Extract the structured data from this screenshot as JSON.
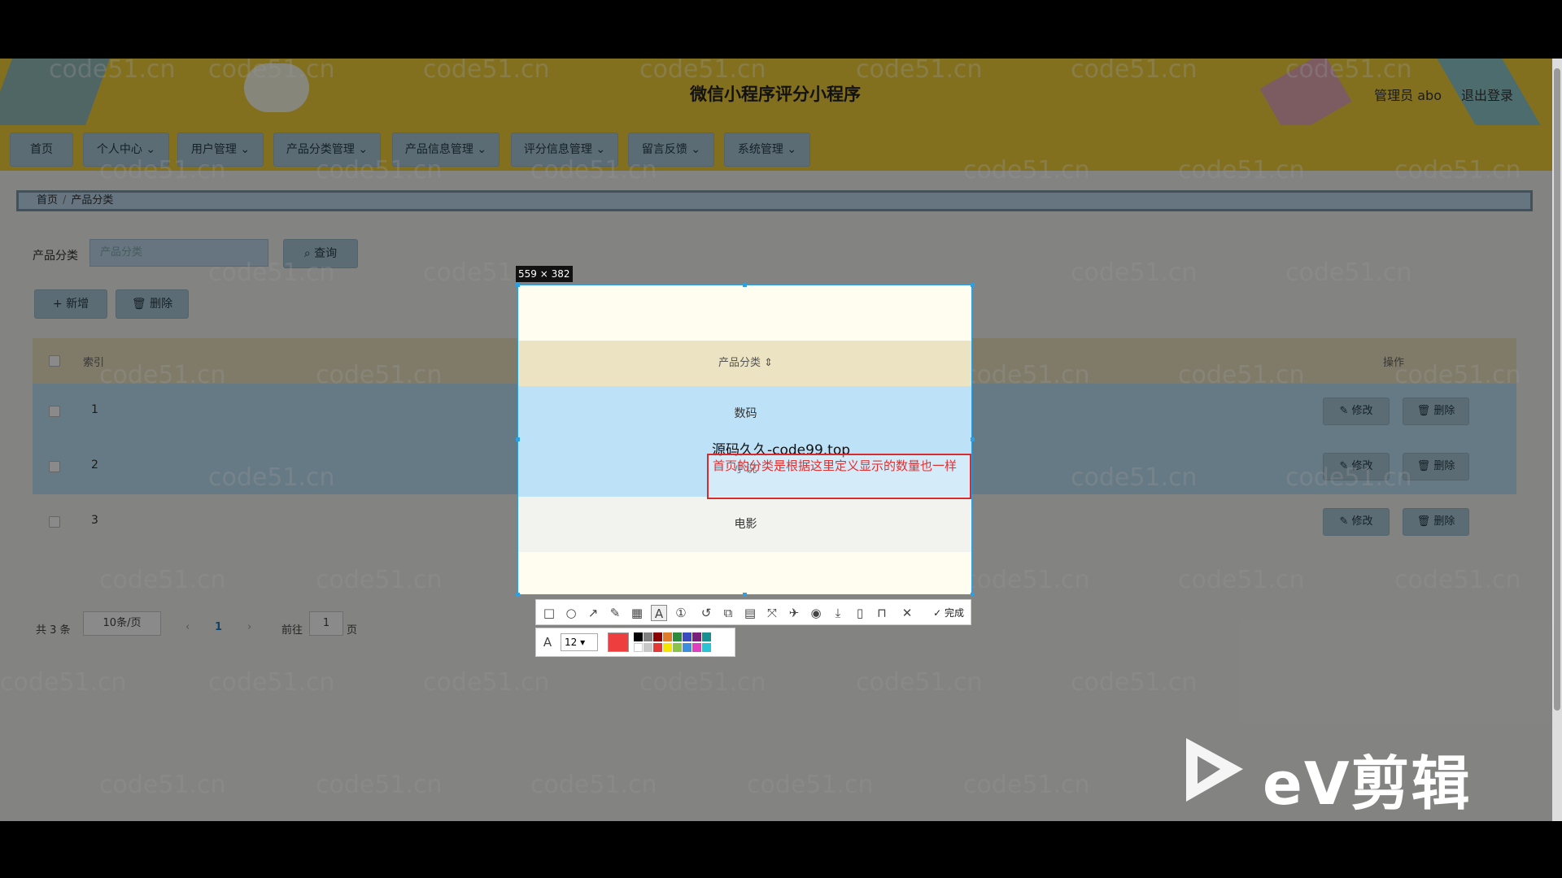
{
  "header": {
    "title": "微信小程序评分小程序",
    "user": "管理员 abo",
    "logout": "退出登录"
  },
  "nav": [
    "首页",
    "个人中心",
    "用户管理",
    "产品分类管理",
    "产品信息管理",
    "评分信息管理",
    "留言反馈",
    "系统管理"
  ],
  "breadcrumb": {
    "home": "首页",
    "current": "产品分类"
  },
  "search": {
    "label": "产品分类",
    "placeholder": "产品分类",
    "button": "查询"
  },
  "actions": {
    "add": "+ 新增",
    "delete": "删除"
  },
  "table": {
    "col_index": "索引",
    "col_category": "产品分类",
    "col_ops": "操作",
    "edit": "修改",
    "delete": "删除",
    "rows": [
      {
        "index": "1",
        "category": "数码"
      },
      {
        "index": "2",
        "category": "小说"
      },
      {
        "index": "3",
        "category": "电影"
      }
    ]
  },
  "pager": {
    "total": "共 3 条",
    "page_size": "10条/页",
    "prev": "‹",
    "current": "1",
    "next": "›",
    "goto": "前往",
    "goto_value": "1",
    "page_suffix": "页"
  },
  "watermark": "code51.cn",
  "snip": {
    "size": "559 × 382",
    "anno_title": "源码久久-code99.top",
    "anno_text": "首页的分类是根据这里定义显示的数量也一样",
    "font_size": "12",
    "done": "完成",
    "current_color": "#ef3e3e"
  },
  "brand": {
    "text": "eV剪辑"
  }
}
